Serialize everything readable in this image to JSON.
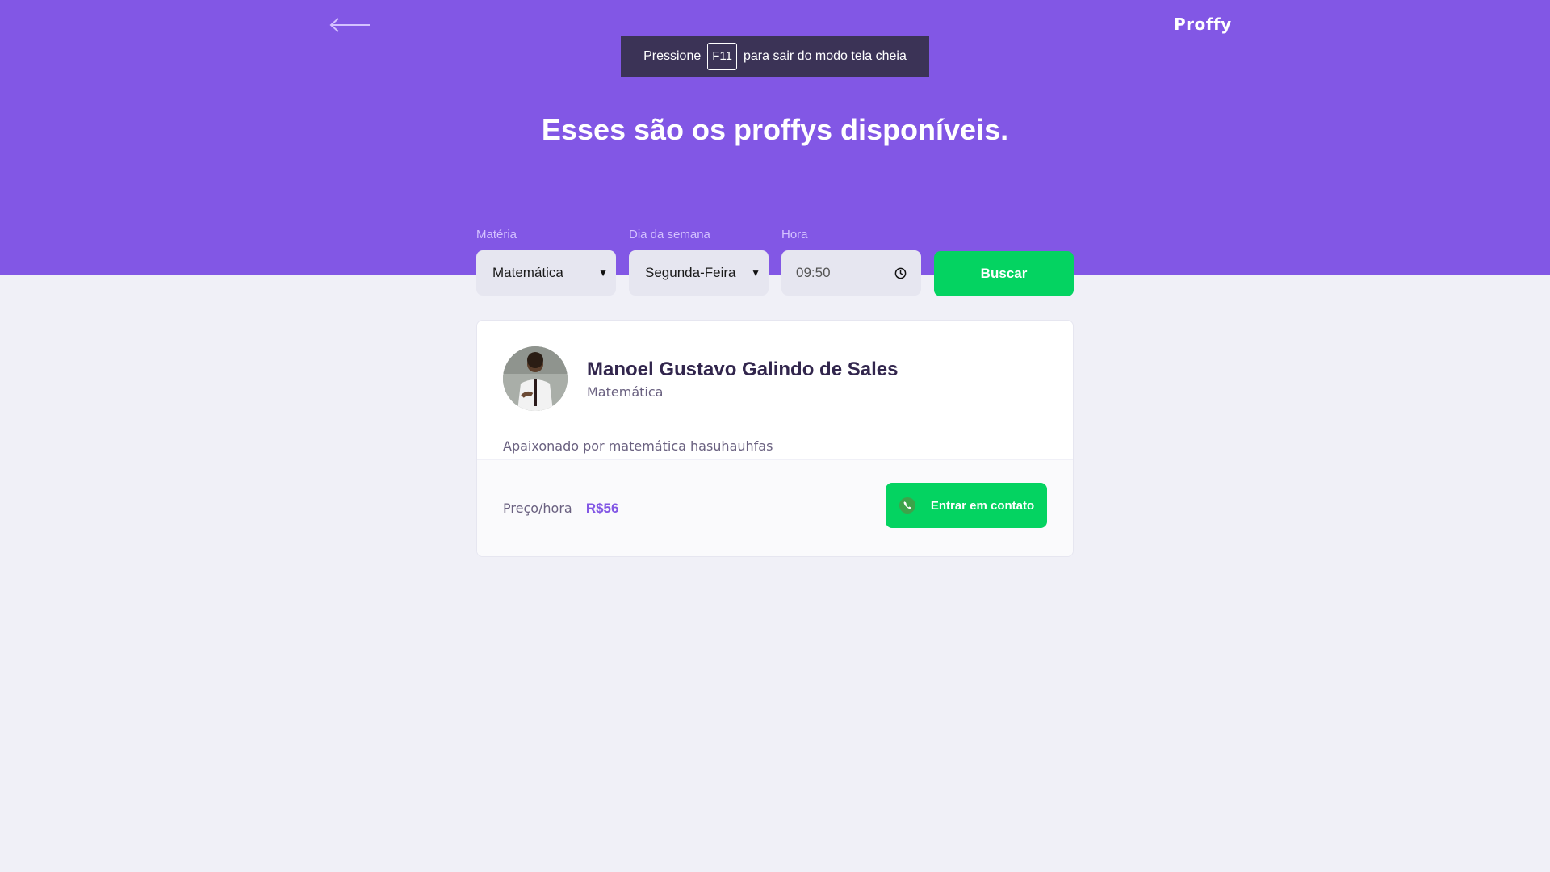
{
  "header": {
    "logo": "Proffy",
    "title": "Esses são os proffys disponíveis.",
    "back_icon": "arrow-left-icon"
  },
  "fullscreen_toast": {
    "prefix": "Pressione",
    "key": "F11",
    "suffix": "para sair do modo tela cheia"
  },
  "filters": {
    "subject": {
      "label": "Matéria",
      "value": "Matemática"
    },
    "weekday": {
      "label": "Dia da semana",
      "value": "Segunda-Feira"
    },
    "time": {
      "label": "Hora",
      "value": "09:50"
    },
    "search_label": "Buscar"
  },
  "teacher": {
    "name": "Manoel Gustavo Galindo de Sales",
    "subject": "Matemática",
    "bio": "Apaixonado por matemática hasuhauhfas",
    "price_label": "Preço/hora",
    "price": "R$56",
    "contact_label": "Entrar em contato"
  },
  "colors": {
    "primary": "#8257e5",
    "secondary": "#04d361",
    "background": "#f0f0f7"
  }
}
